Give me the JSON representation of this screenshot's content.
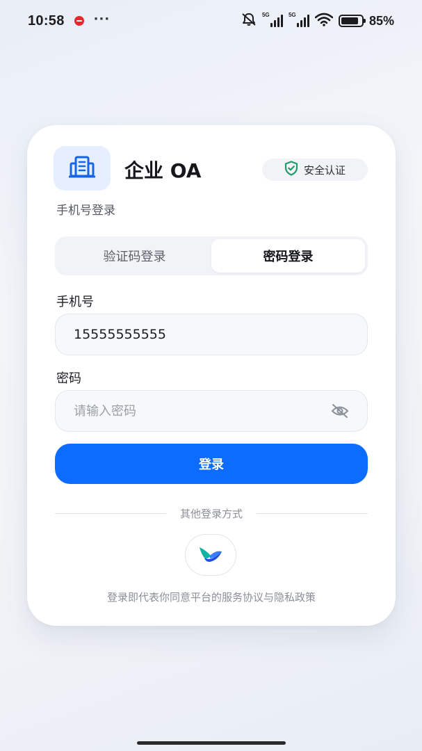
{
  "status_bar": {
    "time": "10:58",
    "network_1": "5G",
    "network_2": "5G",
    "battery_percent": "85%",
    "battery_level": 0.85,
    "icons": [
      "app-notification-icon",
      "more-icon",
      "mute-bell-icon",
      "signal-icon",
      "wifi-icon",
      "battery-icon"
    ]
  },
  "header": {
    "logo_icon": "building-icon",
    "title": "企业 OA",
    "badge_icon": "shield-check-icon",
    "badge_label": "安全认证"
  },
  "subtitle": "手机号登录",
  "tabs": [
    {
      "label": "验证码登录",
      "active": false
    },
    {
      "label": "密码登录",
      "active": true
    }
  ],
  "form": {
    "phone_label": "手机号",
    "phone_value": "15555555555",
    "password_label": "密码",
    "password_value": "",
    "password_placeholder": "请输入密码",
    "visibility_icon": "eye-off-icon"
  },
  "login_button": "登录",
  "other_login": {
    "label": "其他登录方式",
    "provider_icon": "feishu-bird-icon"
  },
  "agreement": "登录即代表你同意平台的服务协议与隐私政策",
  "colors": {
    "accent": "#0b6cff",
    "logo_bg": "#e6efff",
    "badge_icon": "#1f9a6a"
  }
}
